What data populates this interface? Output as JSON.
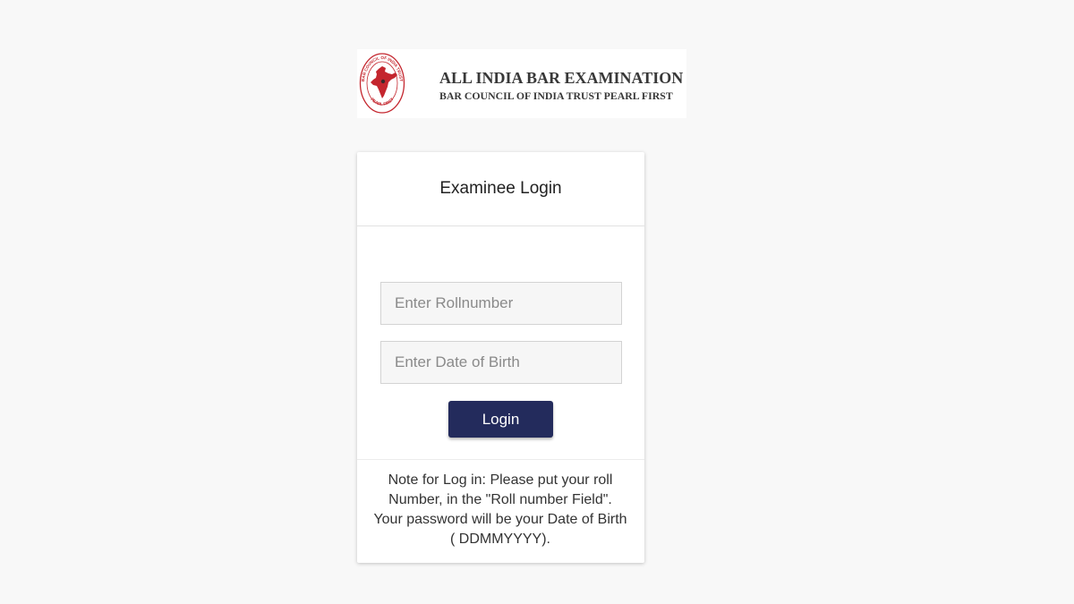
{
  "logo": {
    "title": "ALL INDIA BAR EXAMINATION",
    "subtitle": "BAR COUNCIL OF INDIA TRUST PEARL FIRST",
    "seal": {
      "top_text": "BAR COUNCIL OF INDIA TRUST",
      "bottom_text": "PEARL FIRST",
      "icon": "india-map-icon",
      "color": "#c4262e"
    }
  },
  "login_card": {
    "title": "Examinee Login",
    "rollnumber_field": {
      "placeholder": "Enter Rollnumber",
      "value": ""
    },
    "dob_field": {
      "placeholder": "Enter Date of Birth",
      "value": ""
    },
    "login_button": {
      "label": "Login"
    },
    "note": "Note for Log in: Please put your roll Number, in the \"Roll number Field\". Your password will be your Date of Birth ( DDMMYYYY)."
  },
  "colors": {
    "page_background": "#f8f8f8",
    "accent": "#232b5c",
    "text": "#333333"
  }
}
